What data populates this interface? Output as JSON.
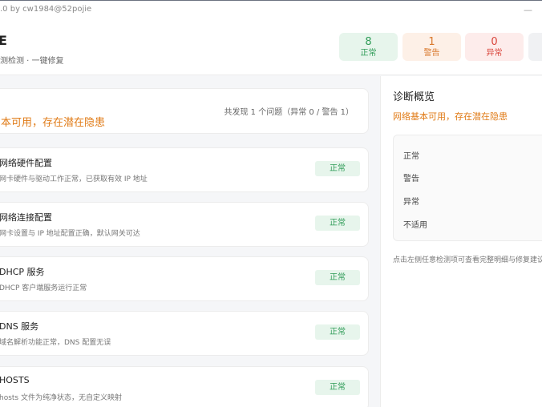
{
  "window": {
    "title": ".0 by cw1984@52pojie",
    "minimize_glyph": "—"
  },
  "header": {
    "title": "E",
    "subtitle": "测检测 · 一键修复"
  },
  "stats": {
    "ok": {
      "value": "8",
      "label": "正常"
    },
    "warn": {
      "value": "1",
      "label": "警告"
    },
    "err": {
      "value": "0",
      "label": "异常"
    }
  },
  "summary": {
    "text": "本可用，存在潜在隐患",
    "count": "共发现 1 个问题（异常 0 / 警告 1）"
  },
  "items": [
    {
      "title": "网络硬件配置",
      "desc": "网卡硬件与驱动工作正常，已获取有效 IP 地址",
      "status": "正常"
    },
    {
      "title": "网络连接配置",
      "desc": "网卡设置与 IP 地址配置正确，默认网关可达",
      "status": "正常"
    },
    {
      "title": "DHCP 服务",
      "desc": "DHCP 客户端服务运行正常",
      "status": "正常"
    },
    {
      "title": "DNS 服务",
      "desc": "域名解析功能正常，DNS 配置无误",
      "status": "正常"
    },
    {
      "title": "HOSTS",
      "desc": "hosts 文件为纯净状态，无自定义映射",
      "status": "正常"
    }
  ],
  "panel": {
    "title": "诊断概览",
    "status": "网络基本可用，存在潜在隐患",
    "rows": [
      "正常",
      "警告",
      "异常",
      "不适用"
    ],
    "hint": "点击左侧任意检测项可查看完整明细与修复建议"
  },
  "colors": {
    "ok": "#2f9c57",
    "warn": "#d9782c",
    "err": "#d9453b",
    "accent_text": "#e07b17"
  }
}
